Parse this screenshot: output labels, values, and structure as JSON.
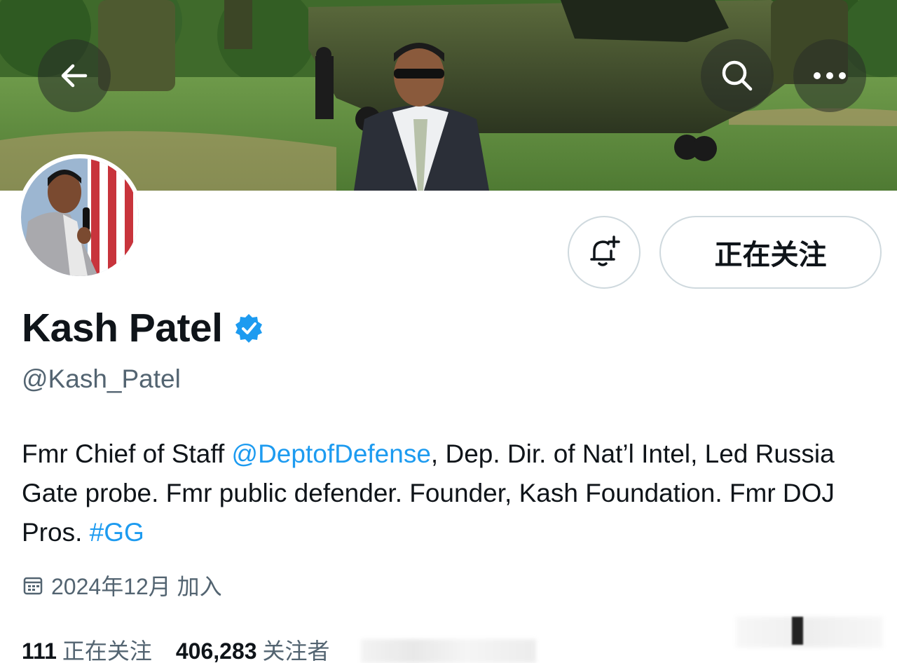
{
  "header": {
    "back_icon": "arrow-left-icon",
    "search_icon": "search-icon",
    "more_icon": "more-horizontal-icon"
  },
  "actions": {
    "notify_icon": "bell-plus-icon",
    "follow_label": "正在关注"
  },
  "profile": {
    "name": "Kash Patel",
    "verified_icon": "verified-badge-icon",
    "handle": "@Kash_Patel",
    "bio": {
      "part1": "Fmr Chief of Staff ",
      "mention": "@DeptofDefense",
      "part2": ", Dep. Dir. of Nat’l Intel, Led Russia Gate probe. Fmr public defender. Founder, Kash Foundation. Fmr DOJ Pros. ",
      "hashtag": "#GG"
    },
    "joined": "2024年12月 加入",
    "calendar_icon": "calendar-icon"
  },
  "stats": {
    "following_count": "111",
    "following_label": "正在关注",
    "followers_count": "406,283",
    "followers_label": "关注者"
  },
  "colors": {
    "accent": "#1d9bf0",
    "text": "#0f1419",
    "secondary": "#536471",
    "border": "#cfd9de"
  }
}
